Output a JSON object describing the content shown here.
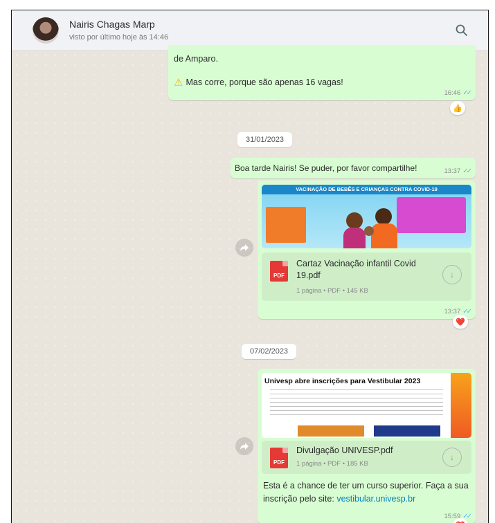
{
  "header": {
    "contact_name": "Nairis Chagas Marp",
    "status": "visto por último hoje às 14:46"
  },
  "messages": {
    "m1": {
      "text_line": "de Amparo.",
      "warning": "Mas corre, porque são apenas 16 vagas!",
      "time": "16:46",
      "reaction": "👍"
    },
    "date1": "31/01/2023",
    "m2": {
      "text": "Boa tarde Nairis! Se puder, por favor compartilhe!",
      "time": "13:37"
    },
    "m3": {
      "poster_title": "VACINAÇÃO DE BEBÊS E CRIANÇAS CONTRA COVID-19",
      "doc_name": "Cartaz Vacinação infantil Covid 19.pdf",
      "doc_meta": "1 página • PDF • 145 KB",
      "time": "13:37",
      "reaction": "❤️"
    },
    "date2": "07/02/2023",
    "m4": {
      "poster_title": "Univesp abre inscrições para Vestibular 2023",
      "doc_name": "Divulgação UNIVESP.pdf",
      "doc_meta": "1 página • PDF • 185 KB",
      "caption": "Esta é a chance de ter um curso superior. Faça a sua inscrição pelo site: ",
      "link": "vestibular.univesp.br",
      "time": "15:59",
      "reaction": "❤️"
    }
  },
  "icons": {
    "pdf_label": "PDF",
    "download": "↓",
    "ticks": "✓✓",
    "warning": "⚠"
  },
  "colors": {
    "outgoing_bubble": "#d9fdd3",
    "chat_bg": "#efeae2",
    "read_ticks": "#53bdeb",
    "pdf_red": "#e53935"
  }
}
